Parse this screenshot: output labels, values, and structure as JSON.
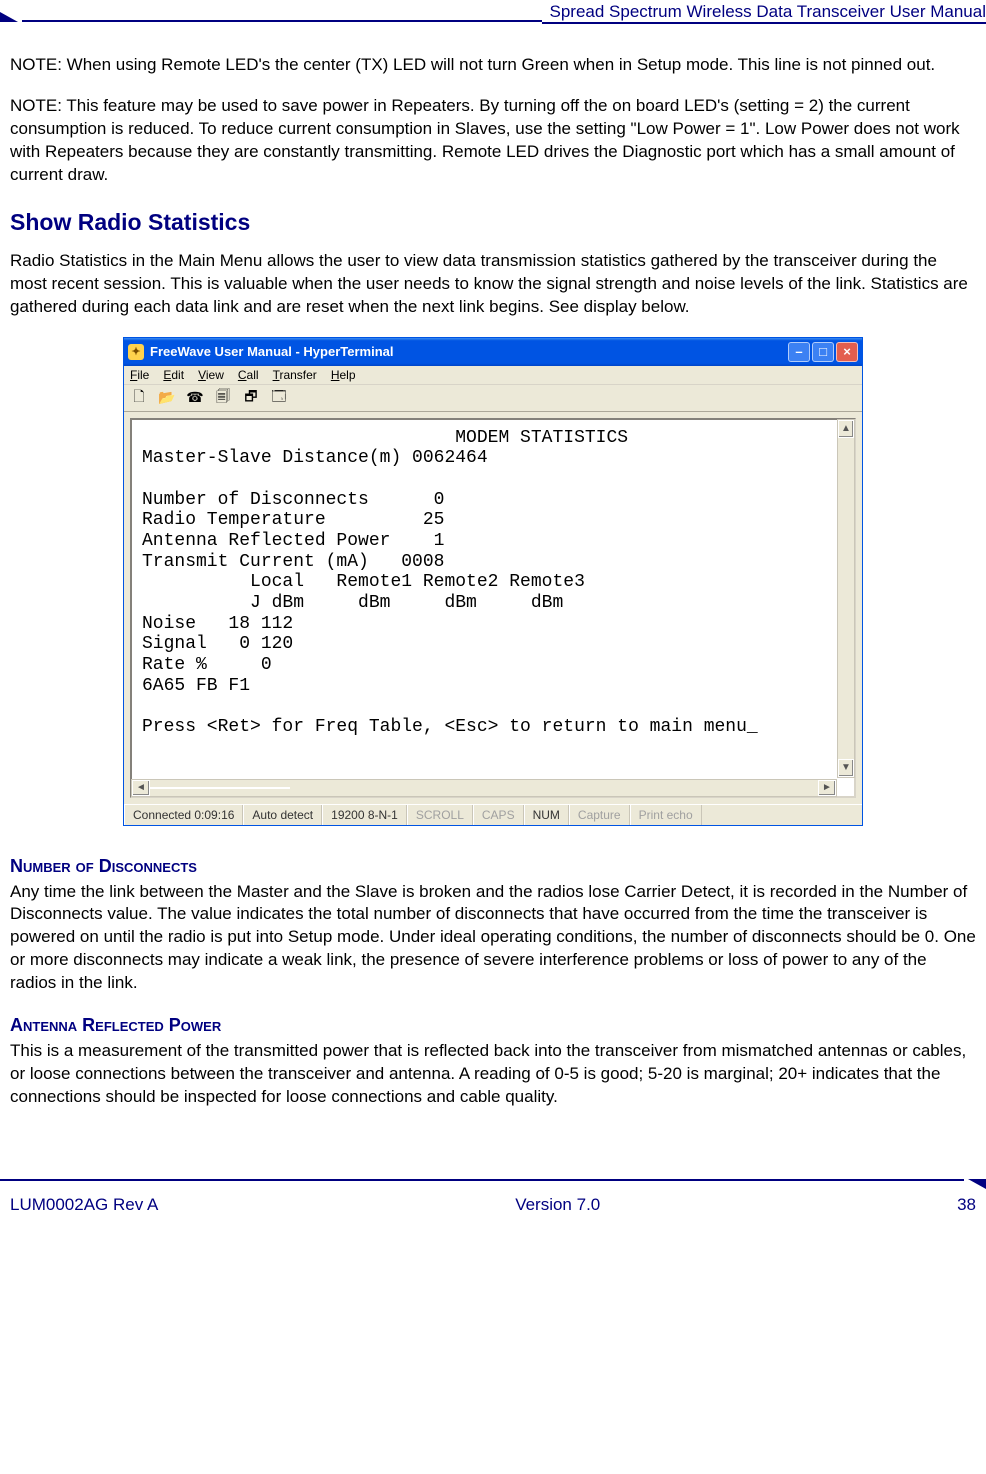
{
  "header": {
    "title": "Spread Spectrum Wireless Data Transceiver User Manual"
  },
  "body": {
    "note1": "NOTE: When using Remote LED's the center (TX) LED will not turn Green when in Setup mode. This line is not pinned out.",
    "note2": "NOTE: This feature may be used to save power in Repeaters.  By turning off the on board LED's (setting = 2) the current consumption is reduced.  To reduce current consumption in Slaves, use the setting \"Low Power = 1\".  Low Power does not work with Repeaters because they are constantly transmitting.  Remote LED drives the Diagnostic port which has a small amount of current draw.",
    "h1": "Show Radio Statistics",
    "p1": "Radio Statistics in the Main Menu allows the user to view data transmission statistics gathered by the transceiver during the most recent session. This is valuable when the user needs to know the signal strength and noise levels of the link. Statistics are gathered during each data link and are reset when the next link begins. See display below.",
    "h2a": "Number of Disconnects",
    "p2a": "Any time the link between the Master and the Slave is broken and the radios lose Carrier Detect, it is recorded in the Number of Disconnects value. The value indicates the total number of disconnects that have occurred from the time the transceiver is powered on until the radio is put into Setup mode. Under ideal operating conditions, the number of disconnects should be 0. One or more disconnects may indicate a weak link, the presence of severe interference problems or loss of power to any of the radios in the link.",
    "h2b": "Antenna Reflected Power",
    "p2b": "This is a measurement of the transmitted power that is reflected back into the transceiver from mismatched antennas or cables, or loose connections between the transceiver and antenna.  A reading of 0-5 is good; 5-20 is marginal; 20+ indicates that the connections should be inspected for loose connections and cable quality."
  },
  "window": {
    "title": "FreeWave User Manual - HyperTerminal",
    "menu": {
      "file": "File",
      "edit": "Edit",
      "view": "View",
      "call": "Call",
      "transfer": "Transfer",
      "help": "Help"
    },
    "terminal_text": "                             MODEM STATISTICS\nMaster-Slave Distance(m) 0062464\n\nNumber of Disconnects      0\nRadio Temperature         25\nAntenna Reflected Power    1\nTransmit Current (mA)   0008\n          Local   Remote1 Remote2 Remote3\n          J dBm     dBm     dBm     dBm\nNoise   18 112\nSignal   0 120\nRate %     0\n6A65 FB F1\n\nPress <Ret> for Freq Table, <Esc> to return to main menu_",
    "status": {
      "connected": "Connected 0:09:16",
      "detect": "Auto detect",
      "port": "19200 8-N-1",
      "scroll": "SCROLL",
      "caps": "CAPS",
      "num": "NUM",
      "capture": "Capture",
      "echo": "Print echo"
    }
  },
  "footer": {
    "left": "LUM0002AG Rev A",
    "center": "Version 7.0",
    "right": "38"
  }
}
